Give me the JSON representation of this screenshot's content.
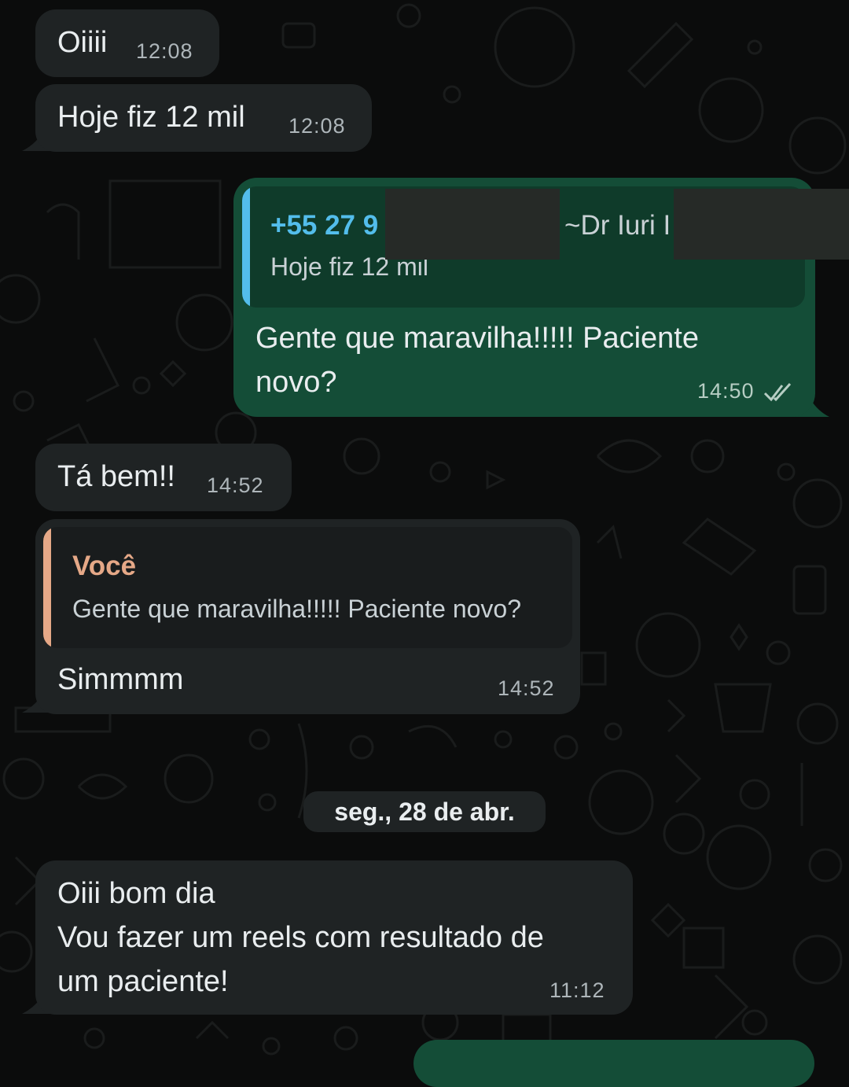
{
  "messages": [
    {
      "text": "Oiiii",
      "time": "12:08"
    },
    {
      "text": "Hoje fiz 12 mil",
      "time": "12:08"
    },
    {
      "quote_sender": "+55 27 9",
      "quote_sender_suffix": "~Dr Iuri I",
      "quote_text": "Hoje fiz 12 mil",
      "text_line1": "Gente que maravilha!!!!! Paciente",
      "text_line2": "novo?",
      "time": "14:50",
      "status_icon": "double-check-icon"
    },
    {
      "text": "Tá bem!!",
      "time": "14:52"
    },
    {
      "quote_sender": "Você",
      "quote_text": "Gente que maravilha!!!!! Paciente novo?",
      "text": "Simmmm",
      "time": "14:52"
    },
    {
      "text_line1": "Oiii bom dia",
      "text_line2": "Vou fazer um reels com resultado de",
      "text_line3": "um paciente!",
      "time": "11:12"
    }
  ],
  "date_separator": "seg., 28 de abr.",
  "colors": {
    "background": "#0b0c0c",
    "incoming_bubble": "#1f2324",
    "outgoing_bubble": "#144d37",
    "quote_sender_outgoing": "#53bdeb",
    "quote_sender_incoming": "#e5a887"
  }
}
